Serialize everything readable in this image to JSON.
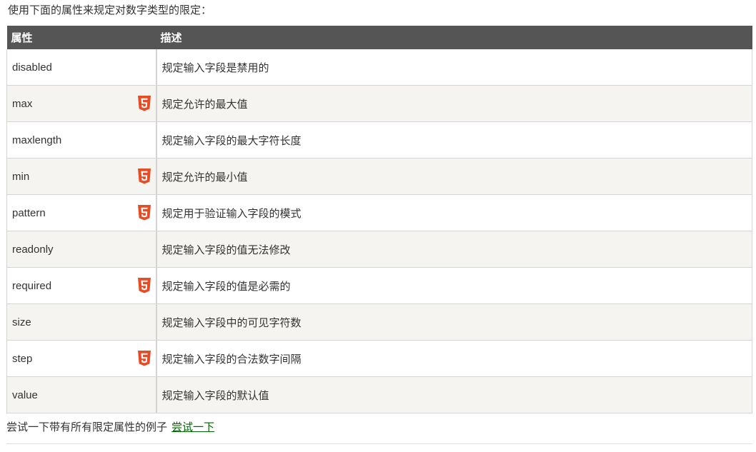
{
  "intro": "使用下面的属性来规定对数字类型的限定：",
  "table": {
    "headers": {
      "attr": "属性",
      "desc": "描述"
    },
    "rows": [
      {
        "attr": "disabled",
        "html5": false,
        "desc": "规定输入字段是禁用的"
      },
      {
        "attr": "max",
        "html5": true,
        "desc": "规定允许的最大值"
      },
      {
        "attr": "maxlength",
        "html5": false,
        "desc": "规定输入字段的最大字符长度"
      },
      {
        "attr": "min",
        "html5": true,
        "desc": "规定允许的最小值"
      },
      {
        "attr": "pattern",
        "html5": true,
        "desc": "规定用于验证输入字段的模式"
      },
      {
        "attr": "readonly",
        "html5": false,
        "desc": "规定输入字段的值无法修改"
      },
      {
        "attr": "required",
        "html5": true,
        "desc": "规定输入字段的值是必需的"
      },
      {
        "attr": "size",
        "html5": false,
        "desc": "规定输入字段中的可见字符数"
      },
      {
        "attr": "step",
        "html5": true,
        "desc": "规定输入字段的合法数字间隔"
      },
      {
        "attr": "value",
        "html5": false,
        "desc": "规定输入字段的默认值"
      }
    ]
  },
  "outro": {
    "text": "尝试一下带有所有限定属性的例子",
    "link": "尝试一下"
  },
  "colors": {
    "header_bg": "#555555",
    "alt_row_bg": "#f6f4f0",
    "html5_badge": "#e44d26",
    "link": "#006600"
  },
  "icons": {
    "html5": "html5-icon"
  }
}
